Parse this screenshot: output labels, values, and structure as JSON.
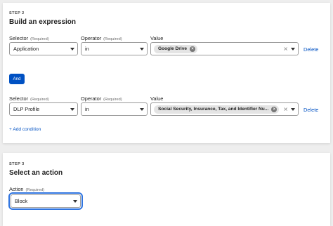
{
  "step2": {
    "step_label": "STEP 2",
    "heading": "Build an expression",
    "rows": [
      {
        "selector_label": "Selector",
        "selector_required": "(Required)",
        "selector_value": "Application",
        "operator_label": "Operator",
        "operator_required": "(Required)",
        "operator_value": "in",
        "value_label": "Value",
        "value_chip": "Google Drive",
        "delete": "Delete"
      },
      {
        "selector_label": "Selector",
        "selector_required": "(Required)",
        "selector_value": "DLP Profile",
        "operator_label": "Operator",
        "operator_required": "(Required)",
        "operator_value": "in",
        "value_label": "Value",
        "value_chip": "Social Security, Insurance, Tax, and Identifier Nu...",
        "delete": "Delete"
      }
    ],
    "and_button": "And",
    "add_condition": "+ Add condition"
  },
  "step3": {
    "step_label": "STEP 3",
    "heading": "Select an action",
    "action_label": "Action",
    "action_required": "(Required)",
    "action_value": "Block"
  },
  "icons": {
    "chip_remove": "x-circle-icon",
    "clear": "close-icon",
    "dropdown": "chevron-down-icon"
  },
  "colors": {
    "accent": "#0051c3",
    "focus_ring": "#2f74e0",
    "chip_bg": "#e4e4e4",
    "background": "#eeeeee"
  }
}
